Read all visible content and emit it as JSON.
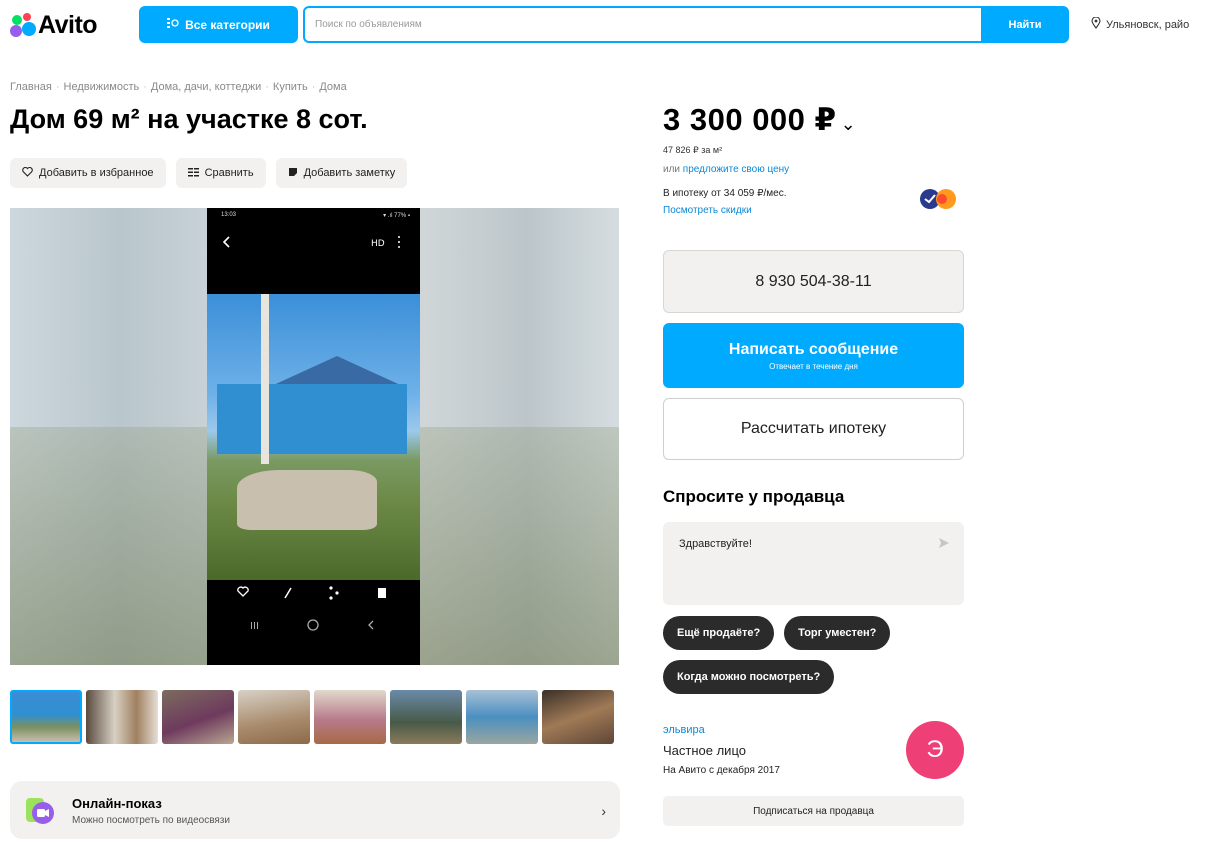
{
  "header": {
    "logo_text": "Avito",
    "categories_label": "Все категории",
    "search_placeholder": "Поиск по объявлениям",
    "search_button": "Найти",
    "location": "Ульяновск, райо"
  },
  "breadcrumb": [
    "Главная",
    "Недвижимость",
    "Дома, дачи, коттеджи",
    "Купить",
    "Дома"
  ],
  "listing": {
    "title": "Дом 69 м² на участке 8 сот.",
    "actions": {
      "favorite": "Добавить в избранное",
      "compare": "Сравнить",
      "note": "Добавить заметку"
    }
  },
  "gallery": {
    "phone_time": "13:03",
    "phone_status": "▾ .ıl 77% ▪",
    "thumbnail_count": 8
  },
  "online_show": {
    "title": "Онлайн-показ",
    "subtitle": "Можно посмотреть по видеосвязи"
  },
  "pricing": {
    "price": "3 300 000 ₽",
    "per_m2": "47 826 ₽ за м²",
    "offer_prefix": "или",
    "offer_link": "предложите свою цену",
    "mortgage": "В ипотеку от 34 059 ₽/мес.",
    "discounts_link": "Посмотреть скидки"
  },
  "contact": {
    "phone": "8 930 504-38-11",
    "message_button": "Написать сообщение",
    "message_sub": "Отвечает в течение дня",
    "mortgage_button": "Рассчитать ипотеку"
  },
  "ask_seller": {
    "title": "Спросите у продавца",
    "message_value": "Здравствуйте!",
    "chips": [
      "Ещё продаёте?",
      "Торг уместен?",
      "Когда можно посмотреть?"
    ]
  },
  "seller": {
    "name": "эльвира",
    "type": "Частное лицо",
    "since": "На Авито с декабря 2017",
    "avatar_letter": "Э",
    "subscribe": "Подписаться на продавца"
  },
  "colors": {
    "accent": "#00aaff",
    "avatar": "#ee3f76",
    "chip": "#2b2b2b"
  }
}
